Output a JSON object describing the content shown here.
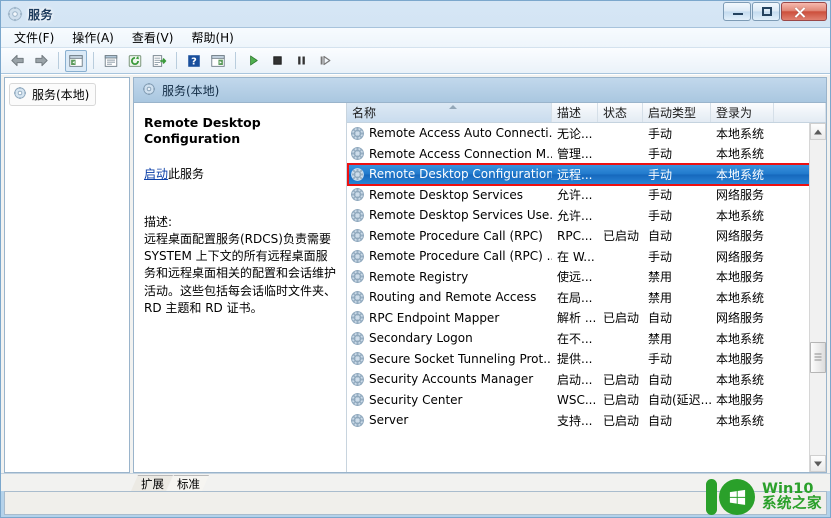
{
  "window": {
    "title": "服务",
    "title_icon": "services-gear-icon",
    "buttons": {
      "minimize": "minimize-icon",
      "maximize": "restore-icon",
      "close": "close-icon"
    }
  },
  "menubar": {
    "items": [
      {
        "label": "文件(F)",
        "accel": "F"
      },
      {
        "label": "操作(A)",
        "accel": "A"
      },
      {
        "label": "查看(V)",
        "accel": "V"
      },
      {
        "label": "帮助(H)",
        "accel": "H"
      }
    ]
  },
  "toolbar": {
    "buttons": [
      {
        "name": "back-icon",
        "glyph": "arrow-left"
      },
      {
        "name": "forward-icon",
        "glyph": "arrow-right"
      },
      {
        "name": "separator",
        "glyph": "sep"
      },
      {
        "name": "show-hide-tree-icon",
        "glyph": "panel"
      },
      {
        "name": "separator",
        "glyph": "sep"
      },
      {
        "name": "properties-icon",
        "glyph": "props"
      },
      {
        "name": "refresh-icon",
        "glyph": "refresh"
      },
      {
        "name": "export-list-icon",
        "glyph": "export"
      },
      {
        "name": "separator",
        "glyph": "sep"
      },
      {
        "name": "help-icon",
        "glyph": "help"
      },
      {
        "name": "show-action-pane-icon",
        "glyph": "actionpane"
      },
      {
        "name": "separator",
        "glyph": "sep"
      },
      {
        "name": "start-service-icon",
        "glyph": "play"
      },
      {
        "name": "stop-service-icon",
        "glyph": "stop"
      },
      {
        "name": "pause-service-icon",
        "glyph": "pause"
      },
      {
        "name": "restart-service-icon",
        "glyph": "restart"
      }
    ]
  },
  "tree": {
    "root_label": "服务(本地)",
    "root_icon": "services-gear-icon"
  },
  "content": {
    "header_label": "服务(本地)",
    "header_icon": "services-gear-icon"
  },
  "details": {
    "service_name": "Remote Desktop Configuration",
    "action_link": "启动",
    "action_suffix": "此服务",
    "description_label": "描述:",
    "description_text": "远程桌面配置服务(RDCS)负责需要 SYSTEM 上下文的所有远程桌面服务和远程桌面相关的配置和会话维护活动。这些包括每会话临时文件夹、RD 主题和 RD 证书。"
  },
  "list": {
    "columns": [
      {
        "label": "名称",
        "sorted": true,
        "sort_dir": "asc"
      },
      {
        "label": "描述",
        "sorted": false,
        "sort_dir": ""
      },
      {
        "label": "状态",
        "sorted": false,
        "sort_dir": ""
      },
      {
        "label": "启动类型",
        "sorted": false,
        "sort_dir": ""
      },
      {
        "label": "登录为",
        "sorted": false,
        "sort_dir": ""
      }
    ],
    "rows": [
      {
        "name": "Remote Access Auto Connecti...",
        "desc": "无论...",
        "status": "",
        "startup": "手动",
        "logon": "本地系统",
        "selected": false
      },
      {
        "name": "Remote Access Connection M...",
        "desc": "管理...",
        "status": "",
        "startup": "手动",
        "logon": "本地系统",
        "selected": false
      },
      {
        "name": "Remote Desktop Configuration",
        "desc": "远程...",
        "status": "",
        "startup": "手动",
        "logon": "本地系统",
        "selected": true
      },
      {
        "name": "Remote Desktop Services",
        "desc": "允许...",
        "status": "",
        "startup": "手动",
        "logon": "网络服务",
        "selected": false
      },
      {
        "name": "Remote Desktop Services Use...",
        "desc": "允许...",
        "status": "",
        "startup": "手动",
        "logon": "本地系统",
        "selected": false
      },
      {
        "name": "Remote Procedure Call (RPC)",
        "desc": "RPC...",
        "status": "已启动",
        "startup": "自动",
        "logon": "网络服务",
        "selected": false
      },
      {
        "name": "Remote Procedure Call (RPC) ...",
        "desc": "在 W...",
        "status": "",
        "startup": "手动",
        "logon": "网络服务",
        "selected": false
      },
      {
        "name": "Remote Registry",
        "desc": "使远...",
        "status": "",
        "startup": "禁用",
        "logon": "本地服务",
        "selected": false
      },
      {
        "name": "Routing and Remote Access",
        "desc": "在局...",
        "status": "",
        "startup": "禁用",
        "logon": "本地系统",
        "selected": false
      },
      {
        "name": "RPC Endpoint Mapper",
        "desc": "解析 ...",
        "status": "已启动",
        "startup": "自动",
        "logon": "网络服务",
        "selected": false
      },
      {
        "name": "Secondary Logon",
        "desc": "在不...",
        "status": "",
        "startup": "禁用",
        "logon": "本地系统",
        "selected": false
      },
      {
        "name": "Secure Socket Tunneling Prot...",
        "desc": "提供...",
        "status": "",
        "startup": "手动",
        "logon": "本地服务",
        "selected": false
      },
      {
        "name": "Security Accounts Manager",
        "desc": "启动...",
        "status": "已启动",
        "startup": "自动",
        "logon": "本地系统",
        "selected": false
      },
      {
        "name": "Security Center",
        "desc": "WSC...",
        "status": "已启动",
        "startup": "自动(延迟...",
        "logon": "本地服务",
        "selected": false
      },
      {
        "name": "Server",
        "desc": "支持...",
        "status": "已启动",
        "startup": "自动",
        "logon": "本地系统",
        "selected": false
      }
    ],
    "scrollbar": {
      "thumb_top_pct": 64,
      "thumb_height_pct": 10
    }
  },
  "tabs": [
    {
      "label": "扩展",
      "active": false
    },
    {
      "label": "标准",
      "active": true
    }
  ],
  "statusbar": {
    "text": ""
  },
  "watermark": {
    "line1": "Win10",
    "line2": "系统之家",
    "color": "#2aa02a"
  },
  "colors": {
    "selection_blue": "#2179cc",
    "annotation_red": "#ee1111",
    "link_blue": "#0b3fa8",
    "header_blue": "#aac7e0"
  }
}
